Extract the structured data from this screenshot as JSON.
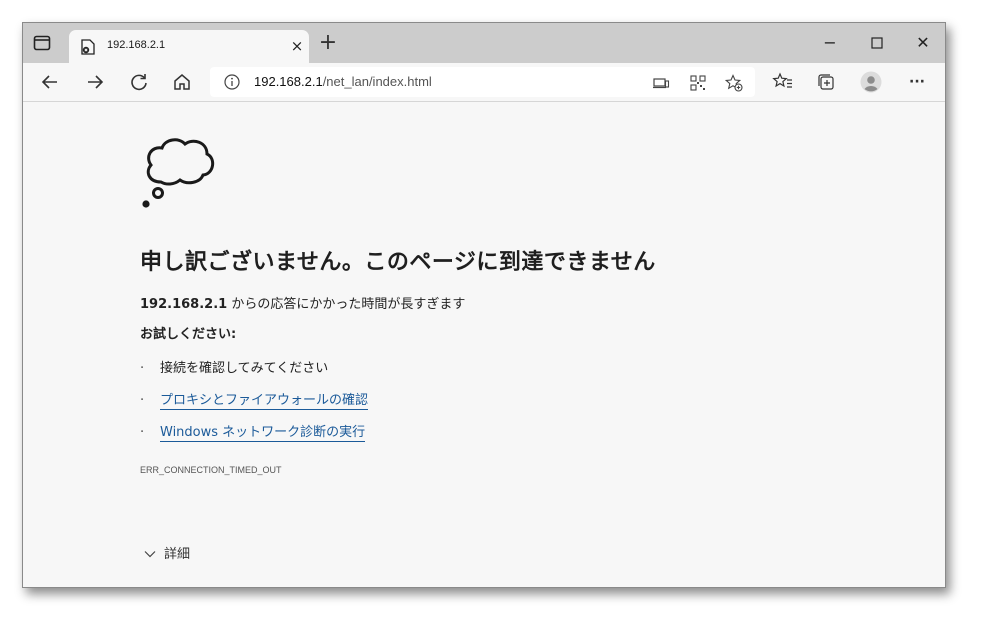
{
  "tab": {
    "title": "192.168.2.1",
    "close": "×",
    "new_tab": "+"
  },
  "window_controls": {
    "minimize": "−",
    "maximize": "☐",
    "close": "✕"
  },
  "address": {
    "host": "192.168.2.1",
    "path": "/net_lan/index.html"
  },
  "toolbar": {
    "more": "···"
  },
  "error": {
    "title": "申し訳ございません。このページに到達できません",
    "host": "192.168.2.1",
    "message": " からの応答にかかった時間が長すぎます",
    "try_label": "お試しください:",
    "suggestions": [
      "接続を確認してみてください",
      "プロキシとファイアウォールの確認",
      "Windows ネットワーク診断の実行"
    ],
    "code": "ERR_CONNECTION_TIMED_OUT",
    "details_label": "詳細"
  },
  "icons": {
    "tab_actions": "tab-actions-icon",
    "favicon": "page-error-icon",
    "back": "back-arrow-icon",
    "forward": "forward-arrow-icon",
    "refresh": "refresh-icon",
    "home": "home-icon",
    "info": "info-icon",
    "cast": "cast-icon",
    "qr": "qr-code-icon",
    "add_favorite": "star-add-icon",
    "favorites": "favorites-icon",
    "collections": "collections-icon",
    "profile": "profile-avatar-icon",
    "cloud": "thought-cloud-icon"
  }
}
